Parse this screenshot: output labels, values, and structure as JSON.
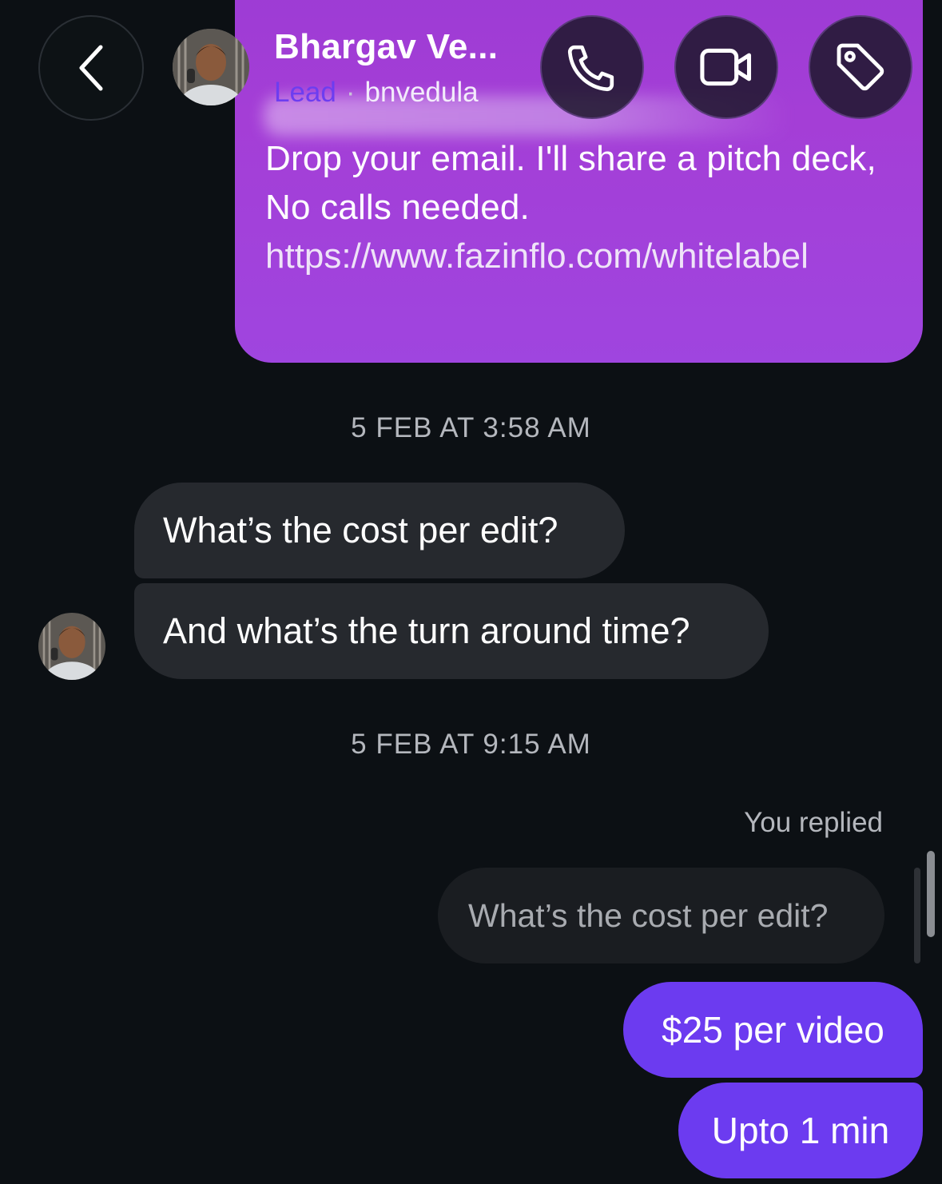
{
  "header": {
    "contact_name": "Bhargav Ve...",
    "label": "Lead",
    "separator": "·",
    "username": "bnvedula",
    "icons": {
      "back": "chevron-left-icon",
      "call": "phone-icon",
      "video": "video-camera-icon",
      "tag": "tag-icon"
    }
  },
  "messages": {
    "top_outgoing": {
      "text": "Drop your email. I'll share a pitch deck, No calls needed.",
      "link": "https://www.fazinflo.com/whitelabel"
    },
    "timestamp_1": "5 FEB AT 3:58 AM",
    "incoming": [
      {
        "text": "What’s the cost per edit?"
      },
      {
        "text": "And what’s the turn around time?"
      }
    ],
    "timestamp_2": "5 FEB AT 9:15 AM",
    "you_replied": "You replied",
    "quoted": "What’s the cost per edit?",
    "outgoing": [
      {
        "text": "$25 per video"
      },
      {
        "text": "Upto 1 min"
      }
    ]
  },
  "colors": {
    "background": "#0c1014",
    "outgoing_bubble": "#6c3bf0",
    "incoming_bubble": "#26292e",
    "lead_label": "#6d3df0"
  }
}
